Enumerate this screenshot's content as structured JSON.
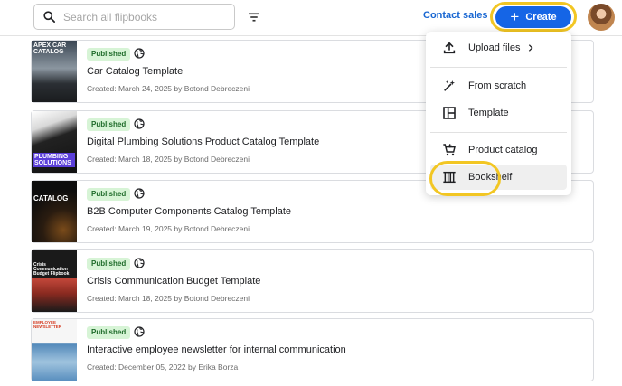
{
  "search": {
    "placeholder": "Search all flipbooks",
    "icon": "search-icon"
  },
  "filter": {
    "icon": "filter-icon"
  },
  "header": {
    "contact_label": "Contact sales",
    "create_label": "Create",
    "create_icon": "plus-icon"
  },
  "colors": {
    "accent": "#1565e6",
    "highlight": "#f2c623",
    "badge_bg": "#d7f4d6",
    "badge_text": "#1e6b2a"
  },
  "flipbooks": [
    {
      "status": "Published",
      "title": "Car Catalog Template",
      "created": "Created: March 24, 2025 by Botond Debreczeni",
      "thumb_text": "APEX CAR CATALOG"
    },
    {
      "status": "Published",
      "title": "Digital Plumbing Solutions Product Catalog Template",
      "created": "Created: March 18, 2025 by Botond Debreczeni",
      "thumb_text": "PLUMBING SOLUTIONS"
    },
    {
      "status": "Published",
      "title": "B2B Computer Components Catalog Template",
      "created": "Created: March 19, 2025 by Botond Debreczeni",
      "thumb_text": "CATALOG"
    },
    {
      "status": "Published",
      "title": "Crisis Communication Budget Template",
      "created": "Created: March 18, 2025 by Botond Debreczeni",
      "thumb_text": "Crisis Communication Budget Flipbook"
    },
    {
      "status": "Published",
      "title": "Interactive employee newsletter for internal communication",
      "created": "Created: December 05, 2022 by Erika Borza",
      "thumb_text": "EMPLOYEE NEWSLETTER"
    }
  ],
  "menu": {
    "items": [
      {
        "label": "Upload files",
        "icon": "upload-icon"
      },
      {
        "label": "From scratch",
        "icon": "magic-wand-icon"
      },
      {
        "label": "Template",
        "icon": "template-icon"
      },
      {
        "label": "Product catalog",
        "icon": "cart-icon"
      },
      {
        "label": "Bookshelf",
        "icon": "bookshelf-icon"
      }
    ]
  }
}
